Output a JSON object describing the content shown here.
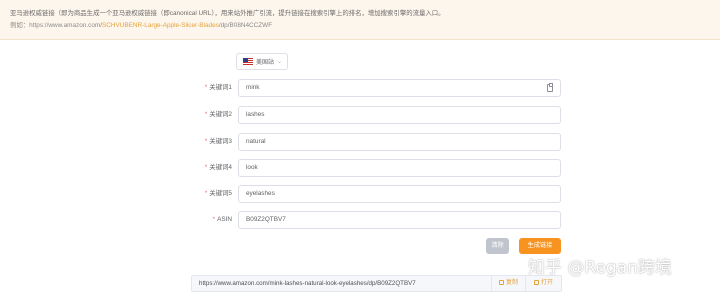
{
  "notice": {
    "description": "亚马逊权威链接（即为商品生成一个亚马逊权威链接（即canonical URL），用来站外推广引流，提升链接在搜索引擎上的排名，增加搜索引擎的流量入口。",
    "example_prefix": "例如：https://www.amazon.com/",
    "example_keywords": "SCHVUBENR-Large-Apple-Slicer-Blades",
    "example_suffix": "/dp/B08N4CCZWF"
  },
  "marketplace": {
    "selected": "美国站",
    "flag_icon": "us-flag-icon",
    "chevron_icon": "chevron-down-icon"
  },
  "form": {
    "rows": [
      {
        "label": "关键词1",
        "value": "mink",
        "required": true
      },
      {
        "label": "关键词2",
        "value": "lashes",
        "required": true
      },
      {
        "label": "关键词3",
        "value": "natural",
        "required": true
      },
      {
        "label": "关键词4",
        "value": "look",
        "required": true
      },
      {
        "label": "关键词5",
        "value": "eyelashes",
        "required": true
      },
      {
        "label": "ASIN",
        "value": "B09Z2QTBV7",
        "required": true
      }
    ],
    "required_mark": "*",
    "clear_label": "清除",
    "generate_label": "生成链接"
  },
  "result": {
    "url": "https://www.amazon.com/mink-lashes-natural-look-eyelashes/dp/B09Z2QTBV7",
    "copy_label": "复制",
    "open_label": "打开"
  },
  "watermark": "知乎 @Regan跨境",
  "colors": {
    "accent": "#f7931e",
    "required": "#f56c6c",
    "notice_bg": "#fdf6ec",
    "link": "#e6a23c"
  }
}
